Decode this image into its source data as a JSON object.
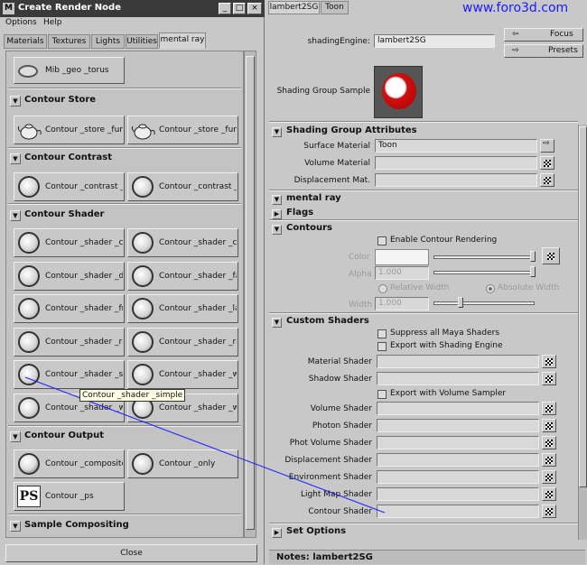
{
  "left_window": {
    "title": "Create Render Node",
    "menu": [
      "Options",
      "Help"
    ],
    "tabs": [
      "Materials",
      "Textures",
      "Lights",
      "Utilities",
      "mental ray"
    ],
    "active_tab": "mental ray",
    "partial_item": "Mib _geo _torus",
    "sections": {
      "contour_store": {
        "title": "Contour Store",
        "items": [
          "Contour _store _func",
          "Contour _store _func"
        ]
      },
      "contour_contrast": {
        "title": "Contour Contrast",
        "items": [
          "Contour _contrast _fu",
          "Contour _contrast _fu"
        ]
      },
      "contour_shader": {
        "title": "Contour Shader",
        "items": [
          "Contour _shader _cur",
          "Contour _shader _cur",
          "Contour _shader _de",
          "Contour _shader _fac",
          "Contour _shader _fra",
          "Contour _shader _lay",
          "Contour _shader _rar",
          "Contour _shader _rar",
          "Contour _shader _sin",
          "Contour _shader _wi",
          "Contour _shader _wi",
          "Contour _shader _wi"
        ]
      },
      "contour_output": {
        "title": "Contour Output",
        "items": [
          "Contour _composite",
          "Contour _only",
          "Contour _ps"
        ]
      },
      "sample_compositing": {
        "title": "Sample Compositing"
      }
    },
    "tooltip": "Contour _shader _simple",
    "close_label": "Close"
  },
  "right_panel": {
    "tabs": [
      "lambert2SG",
      "Toon"
    ],
    "watermark": "www.foro3d.com",
    "shading_engine_label": "shadingEngine:",
    "shading_engine_value": "lambert2SG",
    "focus_label": "Focus",
    "presets_label": "Presets",
    "sample_label": "Shading Group Sample",
    "sections": {
      "attributes": {
        "title": "Shading Group Attributes",
        "surface_label": "Surface Material",
        "surface_value": "Toon",
        "volume_label": "Volume Material",
        "displacement_label": "Displacement Mat."
      },
      "mental_ray": "mental ray",
      "flags": "Flags",
      "contours": {
        "title": "Contours",
        "enable_label": "Enable Contour Rendering",
        "color_label": "Color",
        "alpha_label": "Alpha",
        "alpha_value": "1.000",
        "relative_label": "Relative Width",
        "absolute_label": "Absolute Width",
        "width_label": "Width",
        "width_value": "1.000"
      },
      "custom_shaders": {
        "title": "Custom Shaders",
        "suppress_label": "Suppress all Maya Shaders",
        "export_shading_label": "Export with Shading Engine",
        "material_label": "Material Shader",
        "shadow_label": "Shadow Shader",
        "export_volume_label": "Export with Volume Sampler",
        "volume_label": "Volume Shader",
        "photon_label": "Photon Shader",
        "photvol_label": "Phot Volume Shader",
        "displacement_label": "Displacement Shader",
        "environment_label": "Environment Shader",
        "lightmap_label": "Light Map Shader",
        "contour_label": "Contour Shader"
      },
      "set_options": "Set Options"
    },
    "notes_label": "Notes: lambert2SG"
  },
  "colors": {
    "annotation_line": "#2020ff",
    "sample_ball": "#d01010",
    "watermark": "#1a1aff"
  }
}
